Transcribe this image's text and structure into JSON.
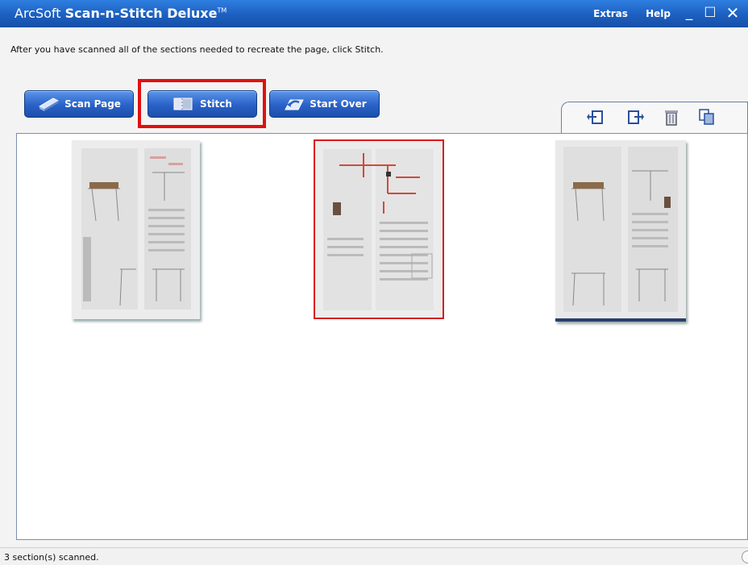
{
  "window": {
    "title_prefix": "ArcSoft",
    "title_main": "Scan-n-Stitch Deluxe",
    "title_tm": "TM",
    "menu": [
      "Extras",
      "Help"
    ],
    "controls": {
      "minimize": "_",
      "maximize": "☐",
      "close": "✕"
    }
  },
  "instruction": "After you have scanned all of the sections needed to recreate the page, click Stitch.",
  "toolbar": {
    "scan_label": "Scan Page",
    "stitch_label": "Stitch",
    "startover_label": "Start Over"
  },
  "tools": [
    "rotate-left-icon",
    "rotate-right-icon",
    "trash-icon",
    "copy-icon"
  ],
  "thumbnails": [
    {
      "name": "scan-section-1",
      "selected": false
    },
    {
      "name": "scan-section-2",
      "selected": true
    },
    {
      "name": "scan-section-3",
      "selected": false
    }
  ],
  "colors": {
    "title_bar": "#1c5fc0",
    "button": "#2a61c8",
    "highlight": "#e01010",
    "selection": "#d81c1c"
  },
  "status": "3 section(s) scanned."
}
